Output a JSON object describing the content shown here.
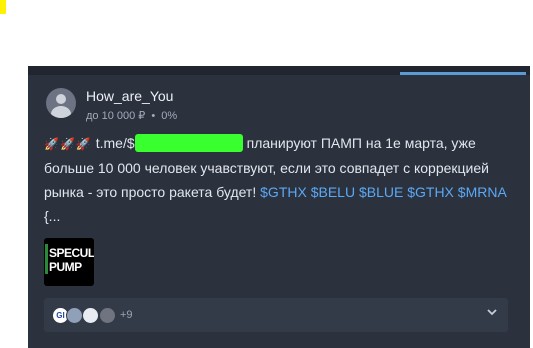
{
  "post": {
    "username": "How_are_You",
    "meta_amount": "до 10 000 ₽",
    "meta_separator": "•",
    "meta_percent": "0%",
    "text_rockets": "🚀🚀🚀",
    "text_link_start": "t.me/$",
    "text_part1": "планируют ПАМП на 1е марта, уже больше 10 000 человек учавствуют, если это совпадет с коррекцией рынка - это просто ракета будет!",
    "tickers": [
      "$GTHX",
      "$BELU",
      "$BLUE",
      "$GTHX",
      "$MRNA"
    ],
    "text_tail": "{...",
    "image_line1": "SPECULA",
    "image_line2": "PUMP"
  },
  "reactions": {
    "avatars": [
      "GI",
      "",
      "",
      ""
    ],
    "more_label": "+9",
    "expand_icon": "chevron-down-icon"
  },
  "colors": {
    "card_bg": "#2b313d",
    "ticker": "#5ba8f5",
    "active_tab": "#5b9bd5",
    "redaction": "#39ff2e"
  }
}
